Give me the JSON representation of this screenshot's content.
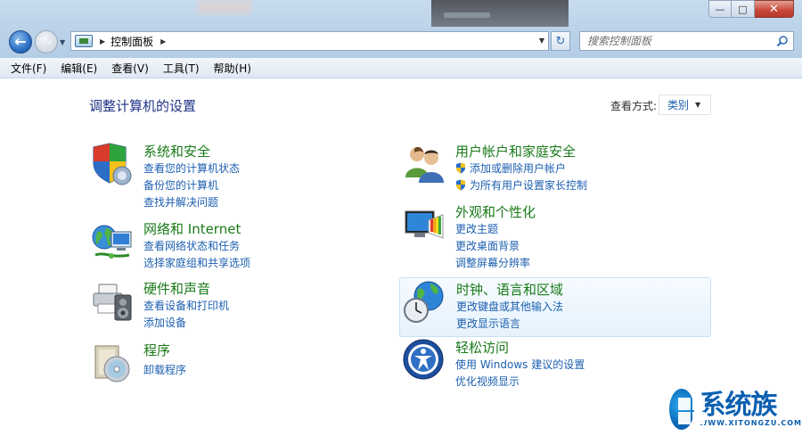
{
  "window": {
    "minimize_glyph": "—",
    "maximize_glyph": "□",
    "close_glyph": "✕"
  },
  "address": {
    "breadcrumb": "控制面板",
    "search_placeholder": "搜索控制面板"
  },
  "menu": {
    "items": [
      {
        "label": "文件(F)"
      },
      {
        "label": "编辑(E)"
      },
      {
        "label": "查看(V)"
      },
      {
        "label": "工具(T)"
      },
      {
        "label": "帮助(H)"
      }
    ]
  },
  "main": {
    "title": "调整计算机的设置",
    "view_by_label": "查看方式:",
    "view_by_value": "类别"
  },
  "categories": {
    "system": {
      "title": "系统和安全",
      "icon": "shield-pc-icon",
      "links": [
        "查看您的计算机状态",
        "备份您的计算机",
        "查找并解决问题"
      ]
    },
    "network": {
      "title": "网络和 Internet",
      "icon": "network-globe-icon",
      "links": [
        "查看网络状态和任务",
        "选择家庭组和共享选项"
      ]
    },
    "hardware": {
      "title": "硬件和声音",
      "icon": "printer-speaker-icon",
      "links": [
        "查看设备和打印机",
        "添加设备"
      ]
    },
    "programs": {
      "title": "程序",
      "icon": "programs-disc-icon",
      "links": [
        "卸载程序"
      ]
    },
    "users": {
      "title": "用户帐户和家庭安全",
      "icon": "users-icon",
      "links": [
        "添加或删除用户帐户",
        "为所有用户设置家长控制"
      ]
    },
    "appearance": {
      "title": "外观和个性化",
      "icon": "monitor-palette-icon",
      "links": [
        "更改主题",
        "更改桌面背景",
        "调整屏幕分辨率"
      ]
    },
    "clock": {
      "title": "时钟、语言和区域",
      "icon": "clock-globe-icon",
      "links": [
        "更改键盘或其他输入法",
        "更改显示语言"
      ]
    },
    "ease": {
      "title": "轻松访问",
      "icon": "ease-of-access-icon",
      "links": [
        "使用 Windows 建议的设置",
        "优化视频显示"
      ]
    }
  },
  "watermark": {
    "cn": "系统族",
    "en": "WWW.XITONGZU.COM"
  }
}
